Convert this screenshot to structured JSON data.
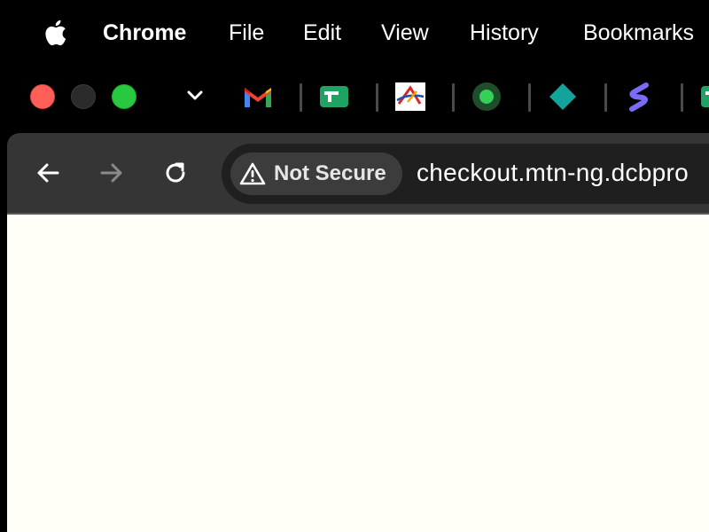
{
  "menubar": {
    "apple_icon": "apple-logo-icon",
    "items": [
      {
        "label": "Chrome"
      },
      {
        "label": "File"
      },
      {
        "label": "Edit"
      },
      {
        "label": "View"
      },
      {
        "label": "History"
      },
      {
        "label": "Bookmarks"
      }
    ]
  },
  "window": {
    "controls": {
      "close_color": "#ff5f57",
      "minimize_color": "#2b2b2b",
      "maximize_color": "#28c840"
    }
  },
  "tabs": {
    "dropdown_icon": "chevron-down-icon",
    "pinned": [
      {
        "icon": "gmail-icon"
      },
      {
        "icon": "green-tab-icon"
      },
      {
        "icon": "red-logo-icon"
      },
      {
        "icon": "green-dot-icon"
      },
      {
        "icon": "teal-diamond-icon"
      },
      {
        "icon": "purple-s-icon"
      },
      {
        "icon": "green-tab-icon"
      }
    ]
  },
  "toolbar": {
    "back_icon": "arrow-left-icon",
    "forward_icon": "arrow-right-icon",
    "reload_icon": "reload-icon",
    "security": {
      "icon": "warning-triangle-icon",
      "label": "Not Secure"
    },
    "url": "checkout.mtn-ng.dcbpro"
  },
  "page": {
    "background": "#fffff7"
  }
}
